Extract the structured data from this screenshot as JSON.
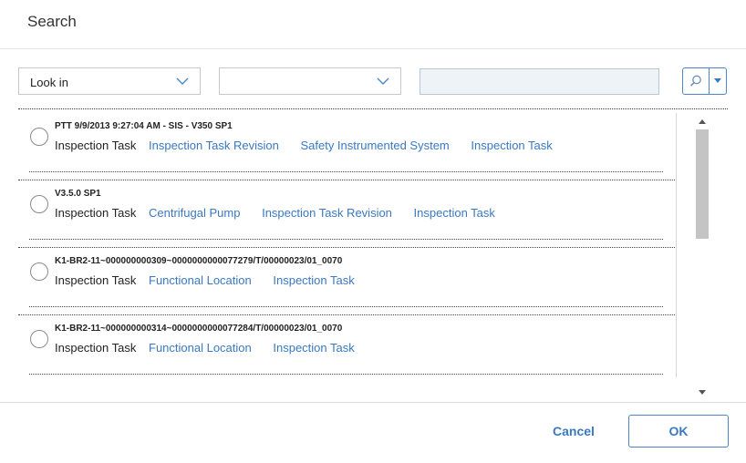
{
  "dialog": {
    "title": "Search"
  },
  "search_bar": {
    "look_in_label": "Look in",
    "type_value": "",
    "query_value": "",
    "search_icon": "magnifier-icon",
    "dropdown_icon": "chevron-down-icon"
  },
  "results": [
    {
      "title": "PTT 9/9/2013 9:27:04 AM - SIS - V350 SP1",
      "family": "Inspection Task",
      "links": [
        "Inspection Task Revision",
        "Safety Instrumented System",
        "Inspection Task"
      ]
    },
    {
      "title": "V3.5.0 SP1",
      "family": "Inspection Task",
      "links": [
        "Centrifugal Pump",
        "Inspection Task Revision",
        "Inspection Task"
      ]
    },
    {
      "title": "K1-BR2-11~000000000309~0000000000077279/T/00000023/01_0070",
      "family": "Inspection Task",
      "links": [
        "Functional Location",
        "Inspection Task"
      ]
    },
    {
      "title": "K1-BR2-11~000000000314~0000000000077284/T/00000023/01_0070",
      "family": "Inspection Task",
      "links": [
        "Functional Location",
        "Inspection Task"
      ]
    }
  ],
  "footer": {
    "cancel_label": "Cancel",
    "ok_label": "OK"
  },
  "colors": {
    "accent": "#3a78c2",
    "input_bg": "#eef3f8"
  }
}
